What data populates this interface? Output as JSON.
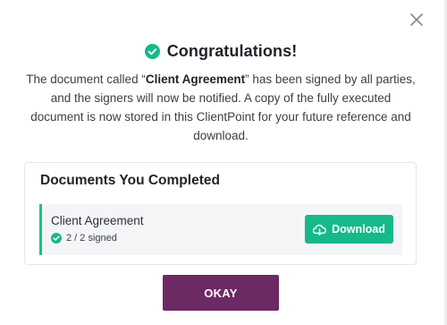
{
  "modal": {
    "title": "Congratulations!",
    "message_parts": {
      "before": "The document called “",
      "doc_name": "Client Agreement",
      "after": "” has been signed by all parties, and the signers will now be notified. A copy of the fully executed document is now stored in this ClientPoint for your future reference and download."
    },
    "docs_section": {
      "heading": "Documents You Completed",
      "items": [
        {
          "name": "Client Agreement",
          "status": "2 / 2 signed",
          "download_label": "Download"
        }
      ]
    },
    "ok_label": "OKAY"
  },
  "icons": {
    "title": "check-circle-icon",
    "close": "close-icon",
    "status": "check-circle-icon",
    "download": "cloud-download-icon"
  },
  "colors": {
    "accent_green": "#17b98a",
    "ok_button": "#6c2a64",
    "row_border": "#1bbf8f"
  }
}
